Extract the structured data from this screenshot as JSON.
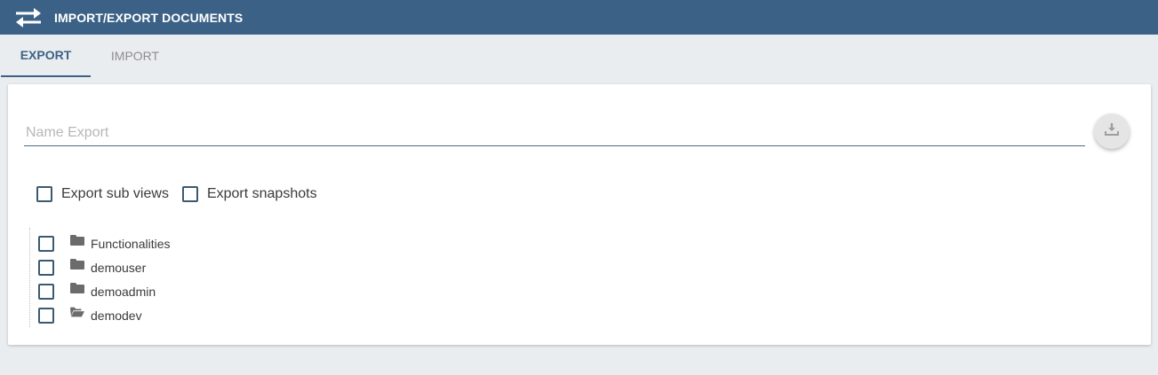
{
  "header": {
    "title": "IMPORT/EXPORT DOCUMENTS",
    "icon": "swap-arrows-icon",
    "bg_color": "#3b6286"
  },
  "tabs": [
    {
      "label": "EXPORT",
      "active": true
    },
    {
      "label": "IMPORT",
      "active": false
    }
  ],
  "export_form": {
    "name_placeholder": "Name Export",
    "name_value": "",
    "download_icon": "download-icon"
  },
  "options": {
    "sub_views_label": "Export sub views",
    "sub_views_checked": false,
    "snapshots_label": "Export snapshots",
    "snapshots_checked": false
  },
  "tree": {
    "items": [
      {
        "name": "Functionalities",
        "icon": "folder-icon",
        "checked": false
      },
      {
        "name": "demouser",
        "icon": "folder-icon",
        "checked": false
      },
      {
        "name": "demoadmin",
        "icon": "folder-icon",
        "checked": false
      },
      {
        "name": "demodev",
        "icon": "folder-open-icon",
        "checked": false
      }
    ]
  }
}
